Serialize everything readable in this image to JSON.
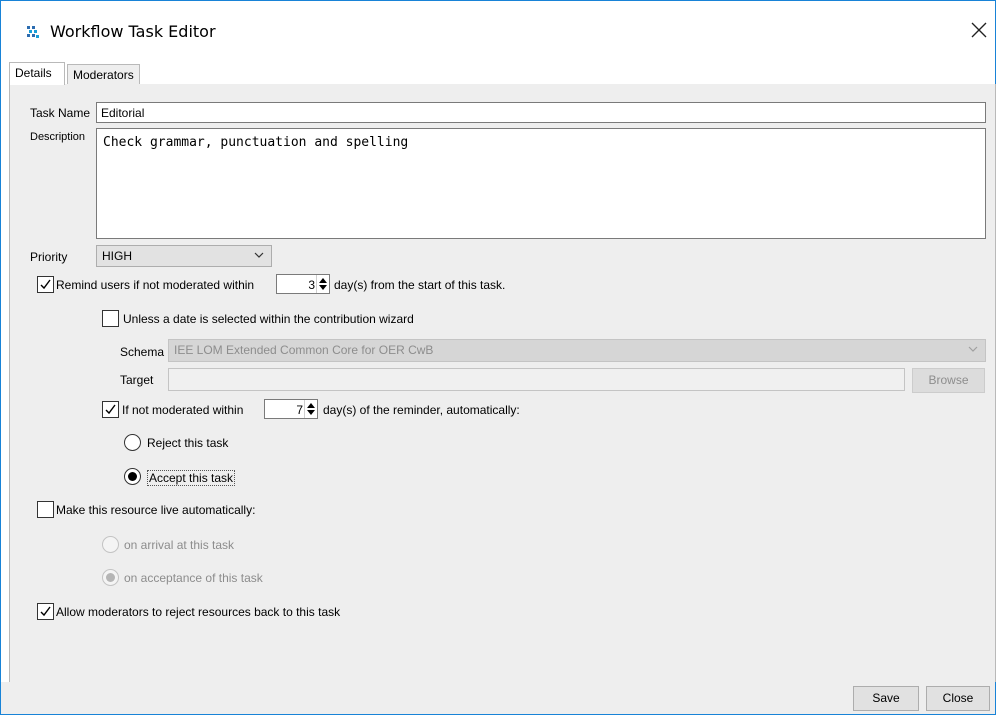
{
  "window": {
    "title": "Workflow Task Editor"
  },
  "tabs": [
    {
      "label": "Details",
      "active": true
    },
    {
      "label": "Moderators",
      "active": false
    }
  ],
  "details": {
    "task_name_label": "Task Name",
    "task_name_value": "Editorial",
    "description_label": "Description",
    "description_value": "Check grammar, punctuation and spelling",
    "priority_label": "Priority",
    "priority_value": "HIGH",
    "remind": {
      "checked": true,
      "label_before": "Remind users if not moderated within",
      "days": "3",
      "label_after": "day(s) from the start of this task."
    },
    "unless_date": {
      "checked": false,
      "label": "Unless a date is selected within the contribution wizard"
    },
    "schema_label": "Schema",
    "schema_value": "IEE LOM Extended Common Core for OER CwB",
    "target_label": "Target",
    "target_value": "",
    "browse_label": "Browse",
    "auto_action": {
      "checked": true,
      "label_before": "If not moderated within",
      "days": "7",
      "label_after": "day(s) of the reminder, automatically:"
    },
    "reject_task_label": "Reject this task",
    "accept_task_label": "Accept this task",
    "selected_action": "accept",
    "make_live": {
      "checked": false,
      "label": "Make this resource live automatically:"
    },
    "on_arrival_label": "on arrival at this task",
    "on_acceptance_label": "on acceptance of this task",
    "allow_reject": {
      "checked": true,
      "label": "Allow moderators to reject resources back to this task"
    }
  },
  "footer": {
    "save_label": "Save",
    "close_label": "Close"
  },
  "colors": {
    "window_border": "#1883d7",
    "panel_bg": "#eeeeee",
    "disabled_text": "#8c8c8c"
  }
}
